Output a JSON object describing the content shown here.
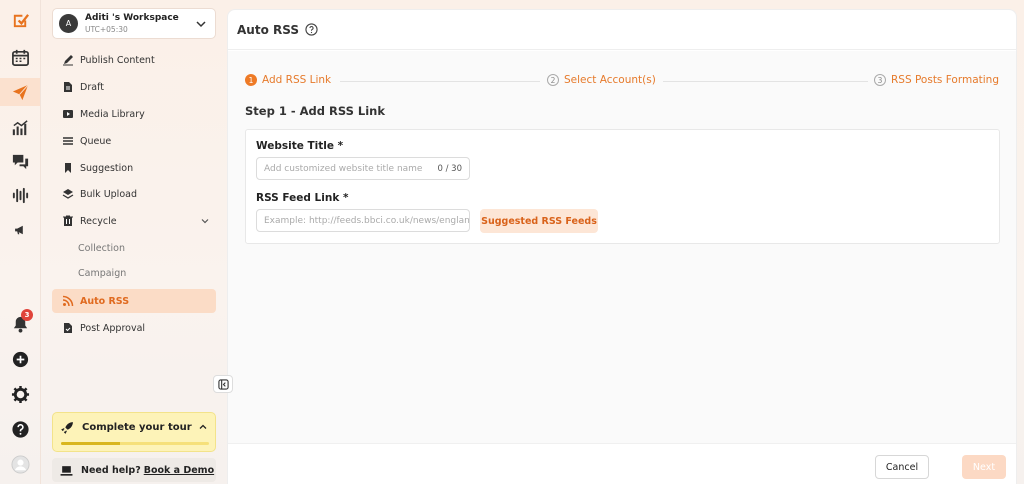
{
  "workspace": {
    "avatar": "A",
    "name": "Aditi 's Workspace",
    "timezone": "UTC+05:30"
  },
  "rail": {
    "icons": [
      "logo-icon",
      "calendar-icon",
      "send-icon",
      "analytics-icon",
      "chat-icon",
      "audio-wave-icon",
      "megaphone-icon",
      "bell-icon",
      "plus-circle-icon",
      "gear-icon",
      "help-icon",
      "profile-icon"
    ],
    "notification_count": "3"
  },
  "sidebar": {
    "items": [
      {
        "label": "Publish Content",
        "icon": "pen-icon"
      },
      {
        "label": "Draft",
        "icon": "document-icon"
      },
      {
        "label": "Media Library",
        "icon": "media-icon"
      },
      {
        "label": "Queue",
        "icon": "queue-icon"
      },
      {
        "label": "Suggestion",
        "icon": "bookmark-icon"
      },
      {
        "label": "Bulk Upload",
        "icon": "layers-icon"
      },
      {
        "label": "Recycle",
        "icon": "recycle-icon"
      },
      {
        "label": "Collection"
      },
      {
        "label": "Campaign"
      },
      {
        "label": "Auto RSS",
        "icon": "rss-icon"
      },
      {
        "label": "Post Approval",
        "icon": "approval-icon"
      }
    ],
    "tour": {
      "label": "Complete your tour",
      "progress": 0.4
    },
    "help": {
      "text": "Need help?",
      "link": "Book a Demo"
    }
  },
  "main": {
    "title": "Auto RSS",
    "steps": [
      {
        "num": "1",
        "label": "Add RSS Link"
      },
      {
        "num": "2",
        "label": "Select Account(s)"
      },
      {
        "num": "3",
        "label": "RSS Posts Formating"
      }
    ],
    "section_title": "Step 1 - Add RSS Link",
    "website_title": {
      "label": "Website Title *",
      "placeholder": "Add customized website title name",
      "counter": "0 / 30"
    },
    "feed_link": {
      "label": "RSS Feed Link *",
      "placeholder": "Example: http://feeds.bbci.co.uk/news/england/rss.xml"
    },
    "suggest_label": "Suggested RSS Feeds",
    "cancel_label": "Cancel",
    "next_label": "Next"
  },
  "colors": {
    "accent": "#ee7a26",
    "accent_light": "#fde6d6",
    "tour_bg": "#fdf3b8"
  }
}
